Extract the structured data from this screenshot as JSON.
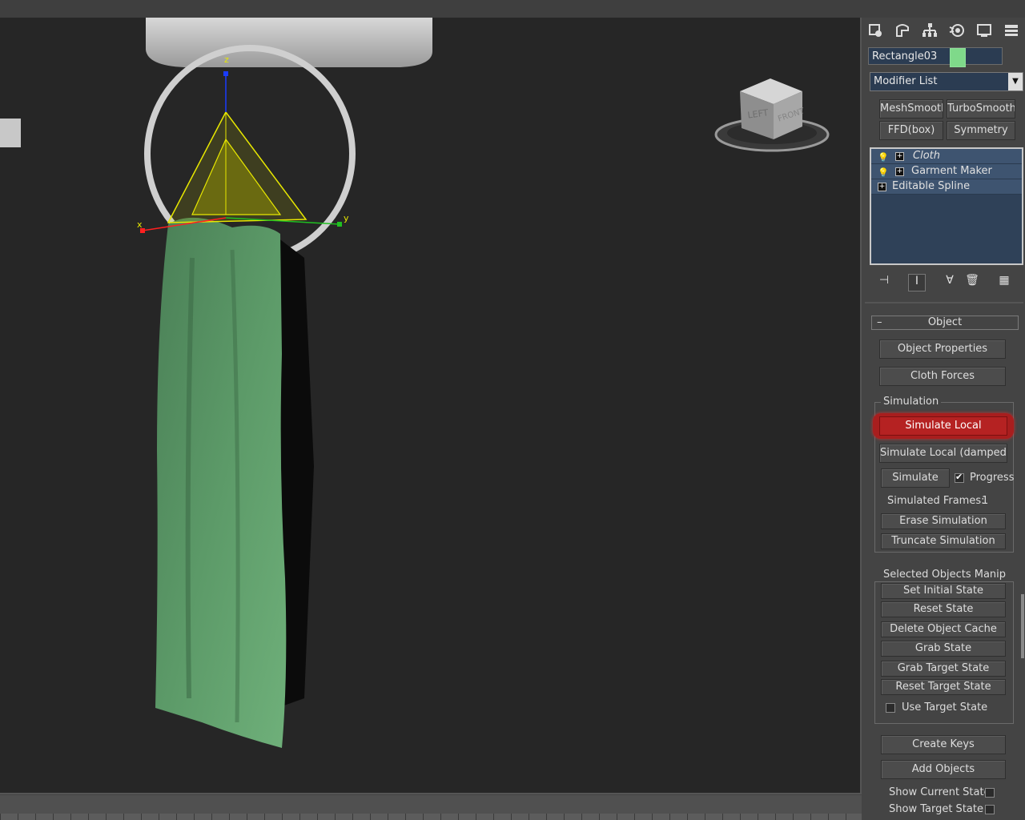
{
  "command_panel": {
    "tab_icons": [
      "select-tab-icon",
      "modify-tab-icon",
      "hierarchy-tab-icon",
      "motion-tab-icon",
      "display-tab-icon",
      "utilities-tab-icon"
    ],
    "object_name": "Rectangle03",
    "object_color": "#7fd98a",
    "modifier_list": "Modifier List",
    "modifier_buttons": [
      "MeshSmooth",
      "TurboSmooth",
      "FFD(box)",
      "Symmetry"
    ],
    "stack": [
      {
        "label": "Cloth",
        "italic": true
      },
      {
        "label": "Garment Maker"
      },
      {
        "label": "Editable Spline"
      }
    ],
    "stack_tool_icons": [
      "pin-stack-icon",
      "show-end-result-icon",
      "make-unique-icon",
      "remove-modifier-icon",
      "configure-modifier-sets-icon"
    ],
    "rollout": {
      "title": "Object",
      "collapse_symbol": "–",
      "object_properties": "Object Properties",
      "cloth_forces": "Cloth Forces",
      "simulation_group": "Simulation",
      "simulate_local": "Simulate Local",
      "simulate_local_damped": "Simulate Local (damped)",
      "simulate": "Simulate",
      "progress_label": "Progress",
      "progress_checked": true,
      "simulated_frames_label": "Simulated Frames:",
      "simulated_frames_value": "1",
      "erase_simulation": "Erase Simulation",
      "truncate_simulation": "Truncate Simulation",
      "selected_group": "Selected Objects Manip",
      "set_initial_state": "Set Initial State",
      "reset_state": "Reset State",
      "delete_object_cache": "Delete Object Cache",
      "grab_state": "Grab State",
      "grab_target_state": "Grab Target State",
      "reset_target_state": "Reset Target State",
      "use_target_state": "Use Target State",
      "use_target_state_checked": false,
      "create_keys": "Create Keys",
      "add_objects": "Add Objects",
      "show_current_state": "Show Current State",
      "show_target_state": "Show Target State"
    }
  },
  "viewport": {
    "gizmo_axes": {
      "x": "x",
      "y": "y",
      "z": "z"
    },
    "viewcube": {
      "left": "LEFT",
      "front": "FRONT"
    },
    "colors": {
      "background": "#262626",
      "cloth": "#5f9e6a",
      "gizmo": "#e8e800",
      "highlight": "#a81e1e"
    }
  }
}
